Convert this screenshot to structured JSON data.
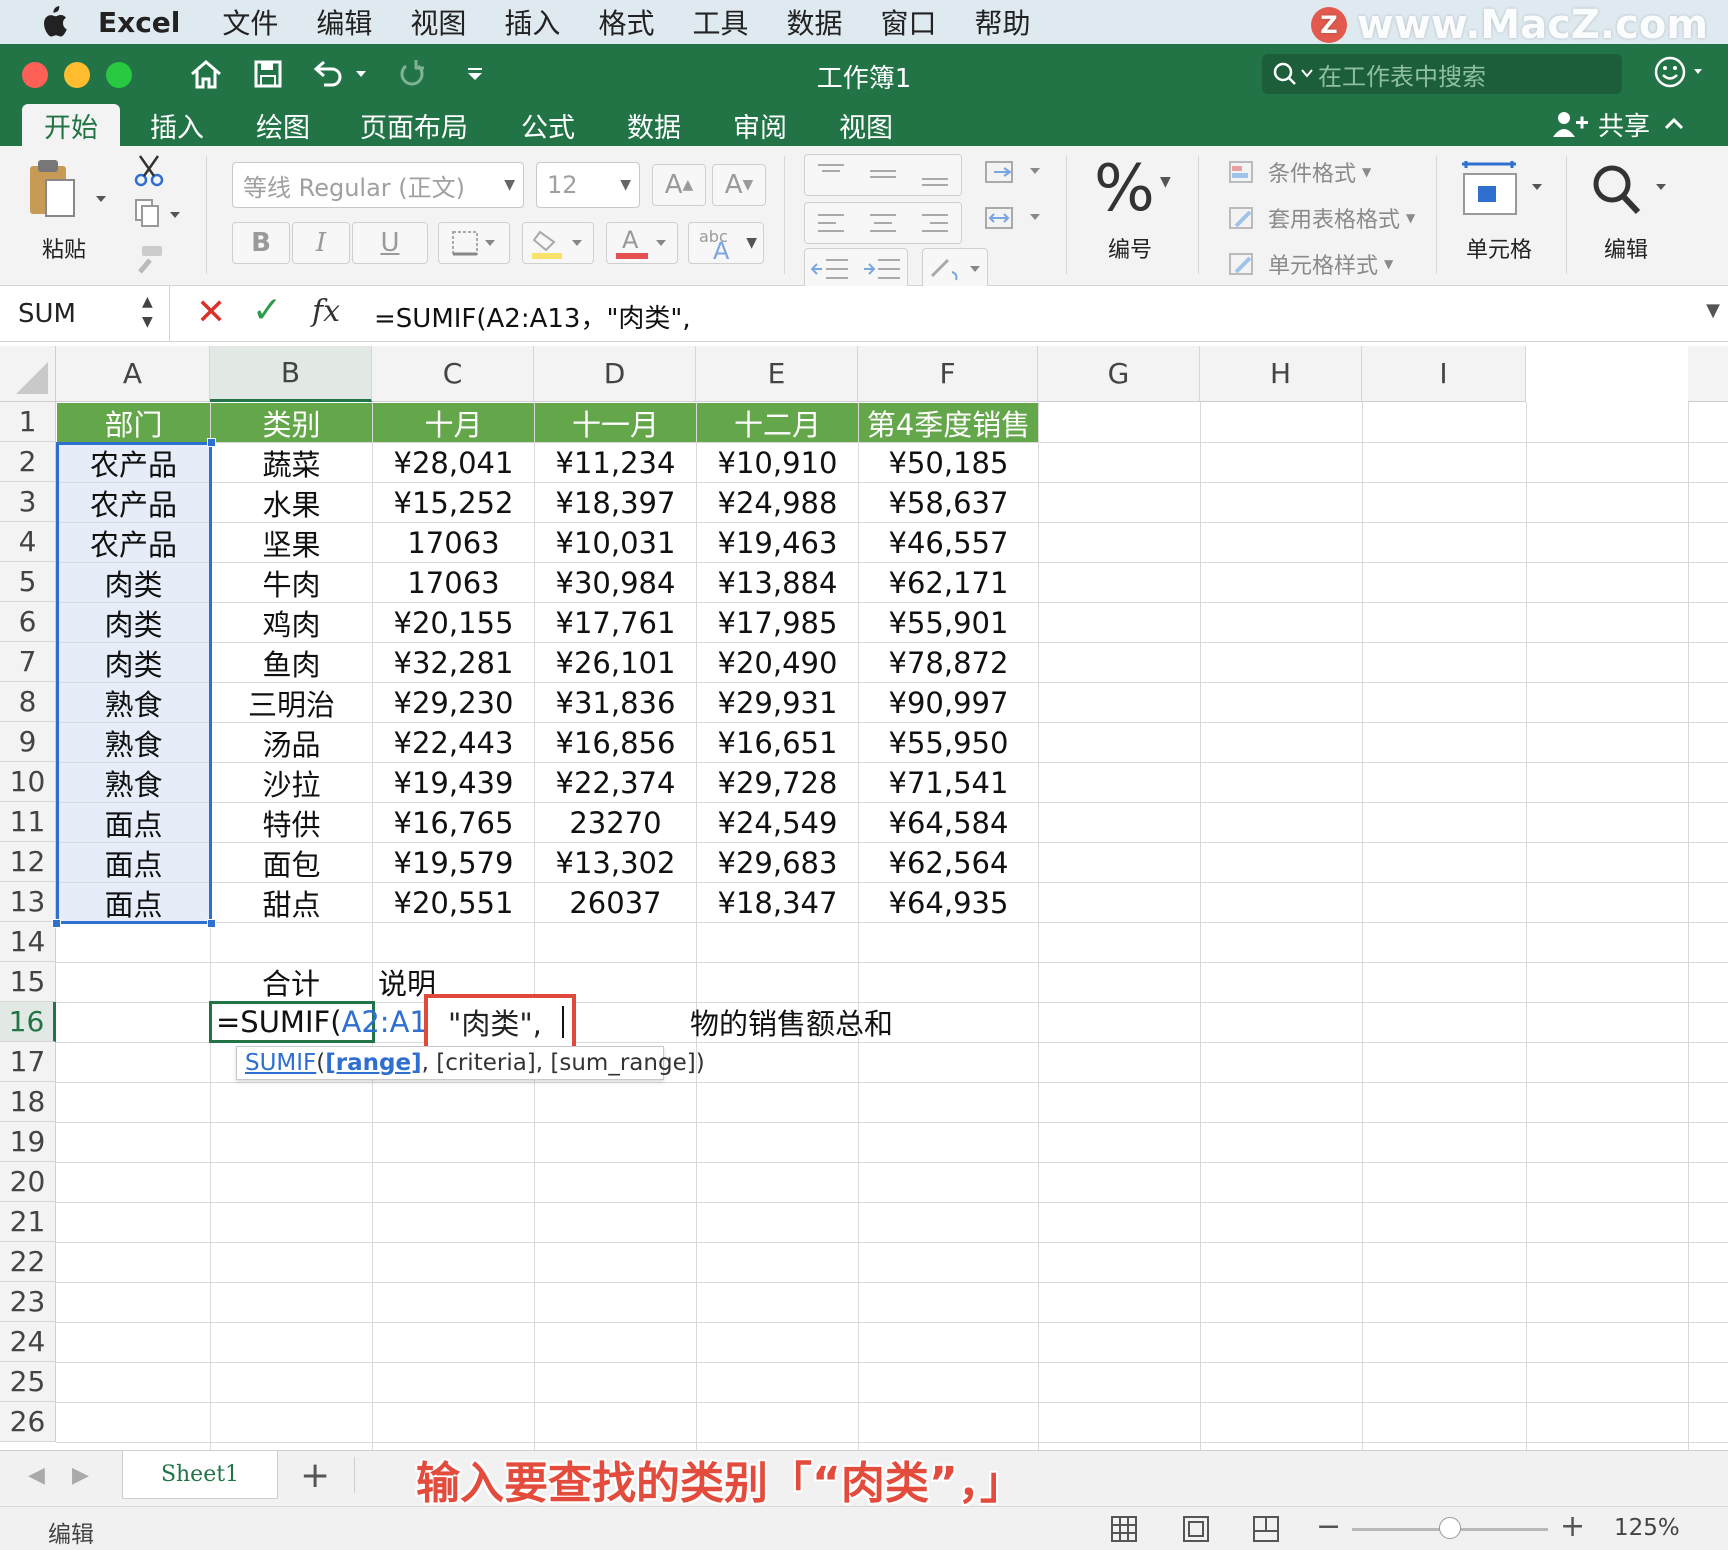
{
  "menubar": {
    "items": [
      "Excel",
      "文件",
      "编辑",
      "视图",
      "插入",
      "格式",
      "工具",
      "数据",
      "窗口",
      "帮助"
    ],
    "watermark": "www.MacZ.com",
    "watermark_badge": "Z"
  },
  "titlebar": {
    "title": "工作簿1",
    "search_placeholder": "在工作表中搜索",
    "share_label": "共享"
  },
  "ribbon_tabs": [
    "开始",
    "插入",
    "绘图",
    "页面布局",
    "公式",
    "数据",
    "审阅",
    "视图"
  ],
  "ribbon": {
    "paste_label": "粘贴",
    "font_name": "等线 Regular (正文)",
    "font_size": "12",
    "number_label": "编号",
    "cond_format": "条件格式",
    "table_format": "套用表格格式",
    "cell_style": "单元格样式",
    "cells_label": "单元格",
    "edit_label": "编辑",
    "bold": "B",
    "italic": "I",
    "underline": "U",
    "grow_font": "A",
    "shrink_font": "A",
    "percent": "%",
    "abc": "abc"
  },
  "formula_bar": {
    "name_box": "SUM",
    "cancel": "✕",
    "enter": "✓",
    "fx": "fx",
    "formula": "=SUMIF(A2:A13，\"肉类\","
  },
  "columns": [
    "A",
    "B",
    "C",
    "D",
    "E",
    "F",
    "G",
    "H",
    "I"
  ],
  "row_numbers": [
    "1",
    "2",
    "3",
    "4",
    "5",
    "6",
    "7",
    "8",
    "9",
    "10",
    "11",
    "12",
    "13",
    "14",
    "15",
    "16",
    "17",
    "18",
    "19",
    "20",
    "21",
    "22",
    "23",
    "24",
    "25",
    "26"
  ],
  "table": {
    "headers": [
      "部门",
      "类别",
      "十月",
      "十一月",
      "十二月",
      "第4季度销售"
    ],
    "rows": [
      [
        "农产品",
        "蔬菜",
        "¥28,041",
        "¥11,234",
        "¥10,910",
        "¥50,185"
      ],
      [
        "农产品",
        "水果",
        "¥15,252",
        "¥18,397",
        "¥24,988",
        "¥58,637"
      ],
      [
        "农产品",
        "坚果",
        "17063",
        "¥10,031",
        "¥19,463",
        "¥46,557"
      ],
      [
        "肉类",
        "牛肉",
        "17063",
        "¥30,984",
        "¥13,884",
        "¥62,171"
      ],
      [
        "肉类",
        "鸡肉",
        "¥20,155",
        "¥17,761",
        "¥17,985",
        "¥55,901"
      ],
      [
        "肉类",
        "鱼肉",
        "¥32,281",
        "¥26,101",
        "¥20,490",
        "¥78,872"
      ],
      [
        "熟食",
        "三明治",
        "¥29,230",
        "¥31,836",
        "¥29,931",
        "¥90,997"
      ],
      [
        "熟食",
        "汤品",
        "¥22,443",
        "¥16,856",
        "¥16,651",
        "¥55,950"
      ],
      [
        "熟食",
        "沙拉",
        "¥19,439",
        "¥22,374",
        "¥29,728",
        "¥71,541"
      ],
      [
        "面点",
        "特供",
        "¥16,765",
        "23270",
        "¥24,549",
        "¥64,584"
      ],
      [
        "面点",
        "面包",
        "¥19,579",
        "¥13,302",
        "¥29,683",
        "¥62,564"
      ],
      [
        "面点",
        "甜点",
        "¥20,551",
        "26037",
        "¥18,347",
        "¥64,935"
      ]
    ]
  },
  "extra_cells": {
    "b15": "合计",
    "c15": "说明",
    "d16_tail": "物的销售额总和"
  },
  "editing": {
    "prefix": "=SUMIF(",
    "range": "A2:A13",
    "criteria": "\"肉类\","
  },
  "tooltip": {
    "fn": "SUMIF",
    "open": "(",
    "arg1": "[range]",
    "rest": ", [criteria], [sum_range])"
  },
  "sheet": {
    "tab": "Sheet1",
    "add": "+",
    "caption": "输入要查找的类别「“肉类”，」"
  },
  "status": {
    "mode": "编辑",
    "zoom": "125%",
    "zoom_fraction": 0.5
  },
  "colors": {
    "excel_green": "#227447",
    "header_green": "#63a74a",
    "ref_blue": "#2f6fcf",
    "highlight_red": "#e04a3c"
  }
}
